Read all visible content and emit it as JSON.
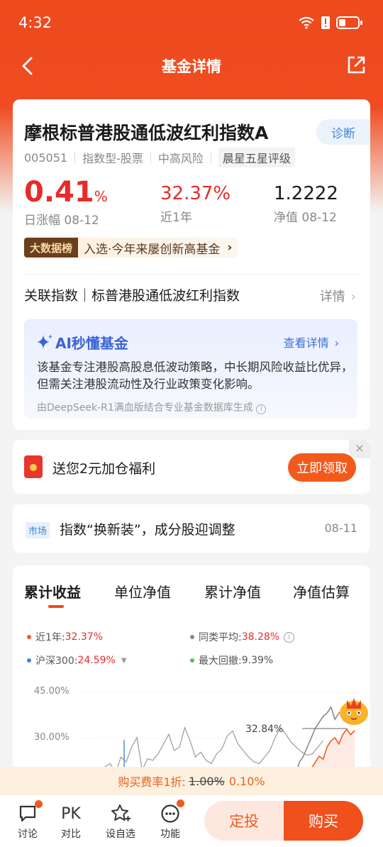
{
  "status": {
    "time": "4:32"
  },
  "nav": {
    "title": "基金详情"
  },
  "fund": {
    "name": "摩根标普港股通低波红利指数A",
    "diag_label": "诊断",
    "code": "005051",
    "type": "指数型-股票",
    "risk": "中高风险",
    "rating": "晨星五星评级",
    "daily_change": "0.41",
    "daily_change_unit": "%",
    "daily_change_label": "日涨幅 08-12",
    "year_return": "32.37%",
    "year_return_label": "近1年",
    "nav_value": "1.2222",
    "nav_label": "净值 08-12",
    "bigdata_badge": "大数据榜",
    "bigdata_text": "入选·今年来屡创新高基金",
    "related_index": "关联指数｜标普港股通低波红利指数",
    "related_detail": "详情"
  },
  "ai": {
    "title": "AI秒懂基金",
    "more": "查看详情",
    "body": "该基金专注港股高股息低波动策略，中长期风险收益比优异，但需关注港股流动性及行业政策变化影响。",
    "source": "由DeepSeek-R1满血版结合专业基金数据库生成"
  },
  "promo": {
    "text": "送您2元加仓福利",
    "button": "立即领取",
    "close": "×"
  },
  "news": {
    "tag": "市场",
    "title": "指数“换新装”，成分股迎调整",
    "date": "08-11"
  },
  "chart_tabs": [
    "累计收益",
    "单位净值",
    "累计净值",
    "净值估算"
  ],
  "legend": {
    "near_year_label": "近1年:",
    "near_year_value": "32.37%",
    "peer_avg_label": "同类平均:",
    "peer_avg_value": "38.28%",
    "hs300_label": "沪深300:",
    "hs300_value": "24.59%",
    "max_dd_label": "最大回撤:",
    "max_dd_value": "9.39%"
  },
  "chart_data": {
    "type": "line",
    "y_tick_labels": [
      "45.00%",
      "30.00%"
    ],
    "ylim": [
      0,
      45
    ],
    "annotation": "32.84%",
    "series": [
      {
        "name": "近1年",
        "color": "#f05a1f",
        "points": [
          0,
          0,
          0,
          0,
          0,
          0,
          0,
          0,
          0,
          0,
          0,
          0,
          0,
          0,
          0,
          0,
          0,
          0,
          0,
          0,
          0,
          0,
          0,
          0,
          0,
          0,
          0,
          0,
          0,
          0,
          0,
          0,
          0,
          0,
          0,
          0,
          0,
          0,
          0,
          0,
          0,
          0,
          0,
          0,
          0,
          0,
          0,
          0,
          0,
          0,
          0,
          0,
          0,
          0,
          0,
          0,
          0,
          0,
          0,
          0,
          0,
          0,
          0,
          0,
          0,
          0,
          0,
          0,
          0,
          0,
          0,
          0,
          0,
          0,
          0,
          0,
          0,
          0,
          0,
          0,
          0,
          0,
          0,
          0,
          0,
          0,
          0,
          0,
          0,
          0,
          0,
          0,
          0,
          0,
          0,
          0,
          2,
          6,
          9,
          12,
          14,
          16,
          18,
          20,
          22,
          24,
          23,
          27,
          29,
          30,
          28,
          31,
          32.84,
          31,
          32.37
        ]
      },
      {
        "name": "同类平均",
        "color": "#8a8a8a",
        "points": [
          0,
          0,
          0,
          0,
          0,
          0,
          0,
          0,
          0,
          0,
          0,
          0,
          0,
          0,
          0,
          0,
          0,
          0,
          0,
          0,
          0,
          0,
          0,
          0,
          0,
          0,
          0,
          0,
          0,
          0,
          0,
          0,
          0,
          0,
          0,
          0,
          0,
          0,
          0,
          0,
          0,
          0,
          0,
          0,
          0,
          0,
          0,
          0,
          0,
          0,
          0,
          0,
          0,
          0,
          0,
          0,
          0,
          0,
          0,
          0,
          0,
          0,
          0,
          0,
          0,
          0,
          0,
          0,
          0,
          0,
          0,
          0,
          0,
          0,
          0,
          0,
          0,
          0,
          0,
          0,
          0,
          0,
          0,
          0,
          0,
          0,
          0,
          0,
          0,
          0,
          0,
          0,
          0,
          0,
          0,
          0,
          4,
          10,
          14,
          18,
          22,
          24,
          27,
          30,
          33,
          35,
          37,
          38,
          40,
          36,
          38,
          39,
          37,
          38.28,
          38
        ]
      },
      {
        "name": "沪深300",
        "color": "#3d86d6",
        "points": [
          0,
          0,
          0,
          0,
          0,
          0,
          0,
          0,
          0,
          0,
          0,
          0,
          0,
          0,
          0,
          0,
          0,
          0,
          0,
          0,
          0,
          0,
          0,
          0,
          0,
          0,
          0,
          0,
          0,
          0,
          0,
          0,
          0,
          0,
          0,
          0,
          0,
          0,
          0,
          0,
          0,
          0,
          0,
          0,
          0,
          0,
          0,
          0,
          0,
          0,
          0,
          0,
          0,
          0,
          0,
          0,
          0,
          0,
          0,
          0,
          0,
          0,
          0,
          0,
          0,
          0,
          0,
          0,
          0,
          0,
          0,
          0,
          0,
          0,
          0,
          0,
          0,
          0,
          0,
          0,
          0,
          0,
          0,
          0,
          0,
          0,
          0,
          0,
          0,
          0,
          0,
          0,
          0,
          0,
          0,
          0,
          1,
          3,
          5,
          7,
          9,
          10,
          12,
          14,
          15,
          17,
          16,
          18,
          20,
          21,
          22,
          23,
          22,
          24,
          24.59
        ]
      }
    ]
  },
  "fee": {
    "prefix": "购买费率1折:",
    "old": "1.00%",
    "new": "0.10%"
  },
  "bottom": {
    "discuss": "讨论",
    "compare_icon": "PK",
    "compare": "对比",
    "watch": "设自选",
    "func": "功能",
    "plan": "定投",
    "buy": "购买"
  },
  "colors": {
    "brand": "#ee4a1e",
    "red": "#e62b2b",
    "blue": "#3d86d6"
  }
}
